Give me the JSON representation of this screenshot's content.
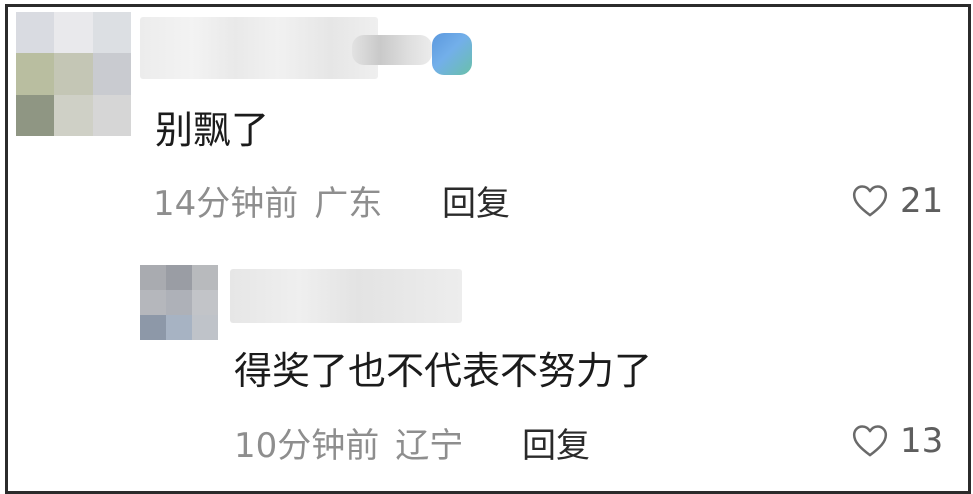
{
  "comments": [
    {
      "avatar_colors": [
        "#d9dbe1",
        "#e9e9ec",
        "#dcdfe3",
        "#b9bea0",
        "#c4c6b5",
        "#c9cbd0",
        "#8f9683",
        "#cfd0c6",
        "#d6d6d6"
      ],
      "text": "别飘了",
      "time": "14分钟前",
      "location": "广东",
      "reply_label": "回复",
      "likes": "21"
    },
    {
      "avatar_colors": [
        "#a9abb0",
        "#9a9da4",
        "#b8babd",
        "#b5b7bc",
        "#aeb1b8",
        "#c2c4c8",
        "#8d98a8",
        "#a7b3c3",
        "#bfc3c9"
      ],
      "text": "得奖了也不代表不努力了",
      "time": "10分钟前",
      "location": "辽宁",
      "reply_label": "回复",
      "likes": "13"
    }
  ]
}
